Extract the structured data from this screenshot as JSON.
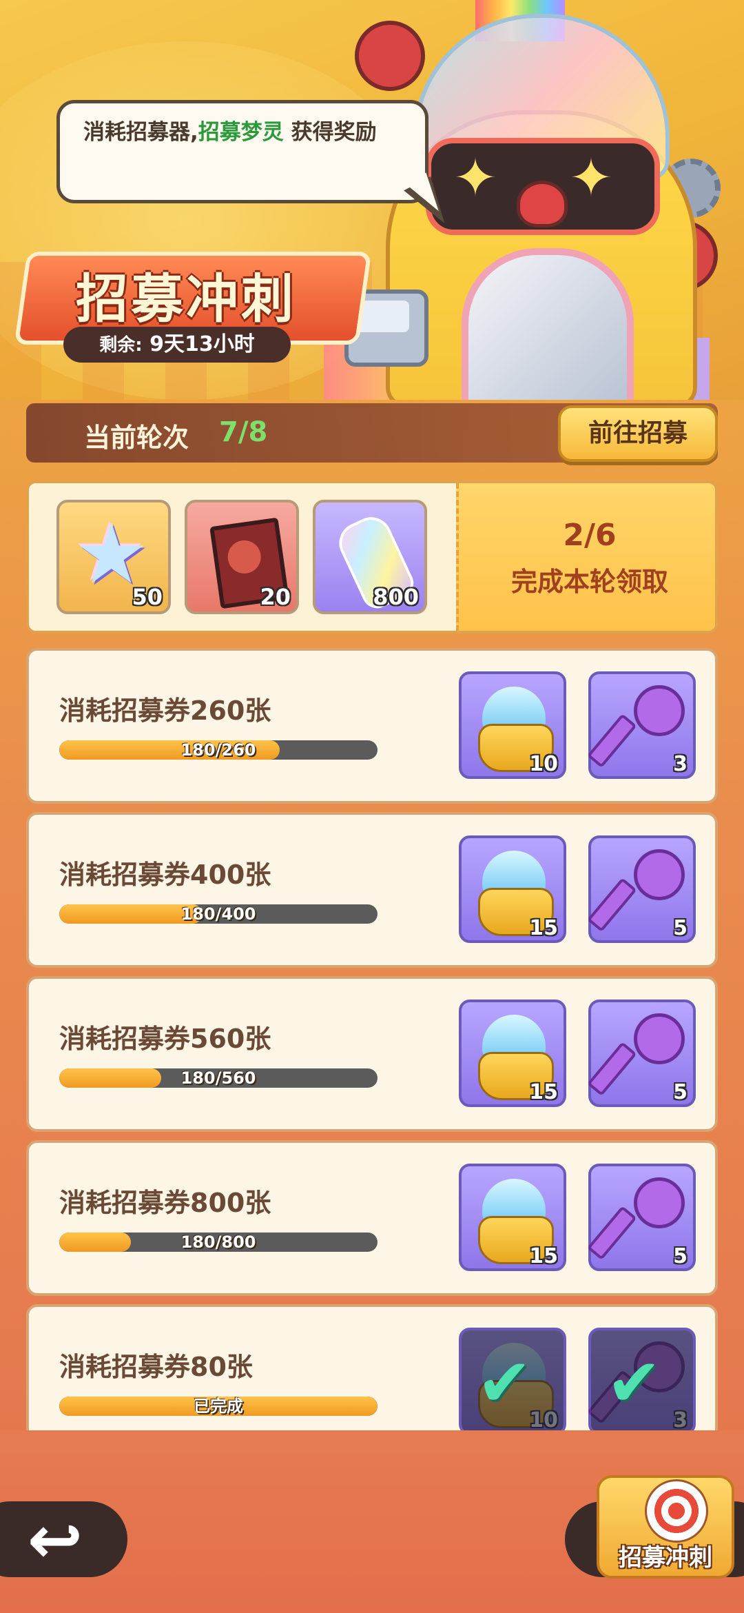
{
  "banner": {
    "speech_prefix": "消耗招募器,",
    "speech_highlight": "招募梦灵",
    "speech_suffix": " 获得奖励",
    "title": "招募冲刺",
    "remaining_label": "剩余:",
    "remaining_value": "9天13小时"
  },
  "round": {
    "label": "当前轮次",
    "value": "7/8",
    "go_button": "前往招募"
  },
  "round_rewards": {
    "items": [
      {
        "icon": "rainbow-star-icon",
        "count": "50"
      },
      {
        "icon": "photo-card-icon",
        "count": "20"
      },
      {
        "icon": "rainbow-bottle-icon",
        "count": "800"
      }
    ],
    "progress": "2/6",
    "hint": "完成本轮领取"
  },
  "tasks": [
    {
      "desc": "消耗招募券260张",
      "progress_text": "180/260",
      "fraction": 0.692,
      "rewards": [
        {
          "icon": "spirit-pot-icon",
          "count": "10"
        },
        {
          "icon": "purple-key-icon",
          "count": "3"
        }
      ],
      "done": false
    },
    {
      "desc": "消耗招募券400张",
      "progress_text": "180/400",
      "fraction": 0.45,
      "rewards": [
        {
          "icon": "spirit-pot-icon",
          "count": "15"
        },
        {
          "icon": "purple-key-icon",
          "count": "5"
        }
      ],
      "done": false
    },
    {
      "desc": "消耗招募券560张",
      "progress_text": "180/560",
      "fraction": 0.321,
      "rewards": [
        {
          "icon": "spirit-pot-icon",
          "count": "15"
        },
        {
          "icon": "purple-key-icon",
          "count": "5"
        }
      ],
      "done": false
    },
    {
      "desc": "消耗招募券800张",
      "progress_text": "180/800",
      "fraction": 0.225,
      "rewards": [
        {
          "icon": "spirit-pot-icon",
          "count": "15"
        },
        {
          "icon": "purple-key-icon",
          "count": "5"
        }
      ],
      "done": false
    },
    {
      "desc": "消耗招募券80张",
      "progress_text": "已完成",
      "fraction": 1.0,
      "rewards": [
        {
          "icon": "spirit-pot-icon",
          "count": "10"
        },
        {
          "icon": "purple-key-icon",
          "count": "3"
        }
      ],
      "done": true
    }
  ],
  "bottom": {
    "back_icon": "back-arrow-icon",
    "entry_label": "招募冲刺"
  }
}
